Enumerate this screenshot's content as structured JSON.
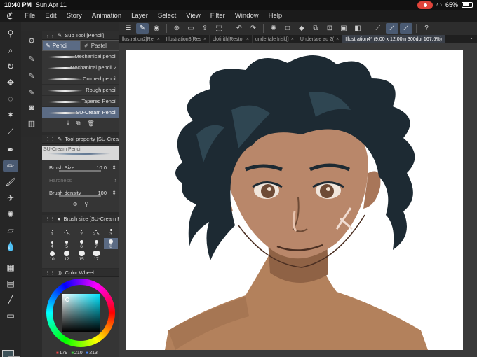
{
  "status_bar": {
    "time": "10:40 PM",
    "date": "Sun Apr 11",
    "battery": "65%",
    "battery_level": 0.65
  },
  "menu": {
    "items": [
      "File",
      "Edit",
      "Story",
      "Animation",
      "Layer",
      "Select",
      "View",
      "Filter",
      "Window",
      "Help"
    ]
  },
  "tabs": [
    {
      "label": "llustration2[Re:",
      "active": false
    },
    {
      "label": "Illustration3[Res",
      "active": false
    },
    {
      "label": "clotirith[Restor",
      "active": false
    },
    {
      "label": "undertale frisk[I",
      "active": false
    },
    {
      "label": "Undertale au 2(",
      "active": false
    },
    {
      "label": "Illustration4* (9.00 x 12.00in 300dpi 167.6%)",
      "active": true
    }
  ],
  "sub_tool": {
    "title": "Sub Tool [Pencil]",
    "tabs": [
      "Pencil",
      "Pastel"
    ],
    "brushes": [
      "Mechanical pencil",
      "Mechanical pencil 2",
      "Colored pencil",
      "Rough pencil",
      "Tapered Pencil",
      "SU-Cream Pencil"
    ],
    "selected": "SU-Cream Pencil"
  },
  "tool_property": {
    "title": "Tool property [SU-Crear",
    "brush_name": "SU-Cream Penci",
    "brush_size_label": "Brush Size",
    "brush_size_value": "10.0",
    "hardness_label": "Hardness",
    "density_label": "Brush density",
    "density_value": "100"
  },
  "brush_size_panel": {
    "title": "Brush size [SU-Cream P",
    "sizes": [
      "1",
      "1.5",
      "2",
      "2.5",
      "3",
      "4",
      "5",
      "6",
      "7",
      "8",
      "10",
      "12",
      "15",
      "17"
    ],
    "selected": "10"
  },
  "color_wheel": {
    "title": "Color Wheel",
    "r": "179",
    "g": "210",
    "b": "213"
  },
  "colors": {
    "main": "#3d5158",
    "sub": "#ffffff",
    "accent": "#5b6b84"
  }
}
